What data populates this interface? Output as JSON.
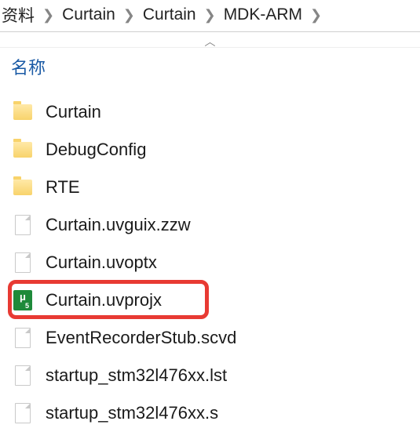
{
  "breadcrumb": {
    "items": [
      "资料",
      "Curtain",
      "Curtain",
      "MDK-ARM"
    ]
  },
  "header": {
    "name_column": "名称"
  },
  "files": [
    {
      "name": "Curtain",
      "type": "folder",
      "highlighted": false
    },
    {
      "name": "DebugConfig",
      "type": "folder",
      "highlighted": false
    },
    {
      "name": "RTE",
      "type": "folder",
      "highlighted": false
    },
    {
      "name": "Curtain.uvguix.zzw",
      "type": "file",
      "highlighted": false
    },
    {
      "name": "Curtain.uvoptx",
      "type": "file",
      "highlighted": false
    },
    {
      "name": "Curtain.uvprojx",
      "type": "keil",
      "highlighted": true
    },
    {
      "name": "EventRecorderStub.scvd",
      "type": "file",
      "highlighted": false
    },
    {
      "name": "startup_stm32l476xx.lst",
      "type": "file",
      "highlighted": false
    },
    {
      "name": "startup_stm32l476xx.s",
      "type": "file",
      "highlighted": false
    }
  ]
}
